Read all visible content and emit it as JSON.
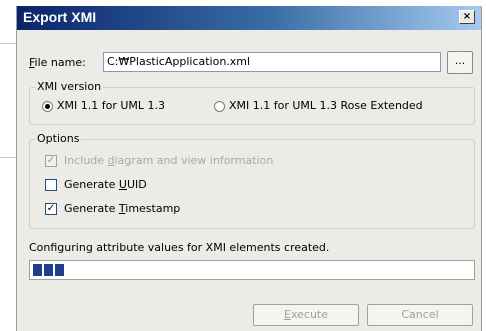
{
  "window": {
    "title": "Export XMI",
    "close_glyph": "×"
  },
  "file": {
    "label_prefix": "",
    "label_accel": "F",
    "label_rest": "ile name:",
    "value": "C:₩PlasticApplication.xml",
    "browse_label": "..."
  },
  "xmi_version": {
    "legend": "XMI version",
    "options": [
      {
        "label": "XMI 1.1 for UML 1.3",
        "selected": true
      },
      {
        "label": "XMI 1.1 for UML 1.3 Rose Extended",
        "selected": false
      }
    ]
  },
  "options": {
    "legend": "Options",
    "include": {
      "pre": "Include ",
      "accel": "d",
      "post": "iagram and view information",
      "checked": true,
      "enabled": false
    },
    "uuid": {
      "pre": "Generate ",
      "accel": "U",
      "post": "UID",
      "checked": false,
      "enabled": true
    },
    "timestamp": {
      "pre": "Generate ",
      "accel": "T",
      "post": "imestamp",
      "checked": true,
      "enabled": true
    }
  },
  "status": {
    "text": "Configuring attribute values for XMI elements created."
  },
  "progress": {
    "fraction": 0.07
  },
  "buttons": {
    "execute": {
      "accel": "E",
      "rest": "xecute"
    },
    "cancel": {
      "label": "Cancel"
    }
  },
  "colors": {
    "title_start": "#0a246a",
    "title_end": "#a6caf0",
    "progress": "#1f3f8c",
    "dialog_bg": "#ecebe6"
  }
}
